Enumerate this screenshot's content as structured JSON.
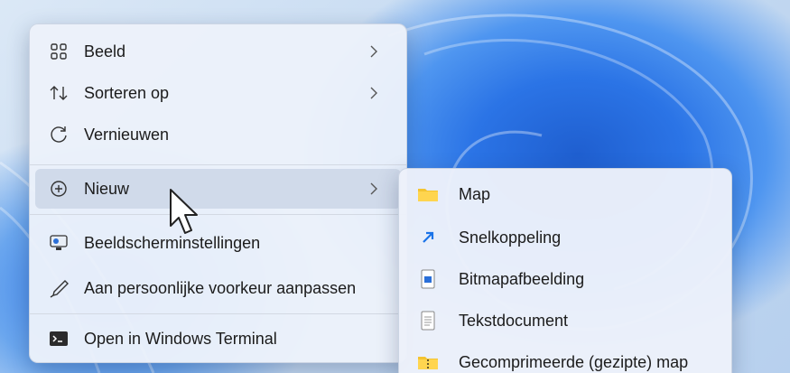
{
  "context_menu": {
    "items": [
      {
        "label": "Beeld",
        "icon": "grid-view-icon",
        "has_submenu": true
      },
      {
        "label": "Sorteren op",
        "icon": "sort-arrows-icon",
        "has_submenu": true
      },
      {
        "label": "Vernieuwen",
        "icon": "refresh-icon",
        "has_submenu": false
      },
      {
        "label": "Nieuw",
        "icon": "add-circle-icon",
        "has_submenu": true,
        "highlighted": true
      },
      {
        "label": "Beeldscherminstellingen",
        "icon": "display-settings-icon",
        "has_submenu": false
      },
      {
        "label": "Aan persoonlijke voorkeur aanpassen",
        "icon": "pen-brush-icon",
        "has_submenu": false
      },
      {
        "label": "Open in Windows Terminal",
        "icon": "terminal-icon",
        "has_submenu": false
      }
    ]
  },
  "new_submenu": {
    "items": [
      {
        "label": "Map",
        "icon": "folder-icon"
      },
      {
        "label": "Snelkoppeling",
        "icon": "shortcut-arrow-icon"
      },
      {
        "label": "Bitmapafbeelding",
        "icon": "bitmap-image-icon"
      },
      {
        "label": "Tekstdocument",
        "icon": "text-document-icon"
      },
      {
        "label": "Gecomprimeerde (gezipte) map",
        "icon": "zip-folder-icon"
      }
    ]
  },
  "colors": {
    "accent": "#1a73e8",
    "folder_yellow": "#f4c430",
    "menu_bg": "#ecf1fa",
    "hover_bg": "#cdd7e8"
  }
}
